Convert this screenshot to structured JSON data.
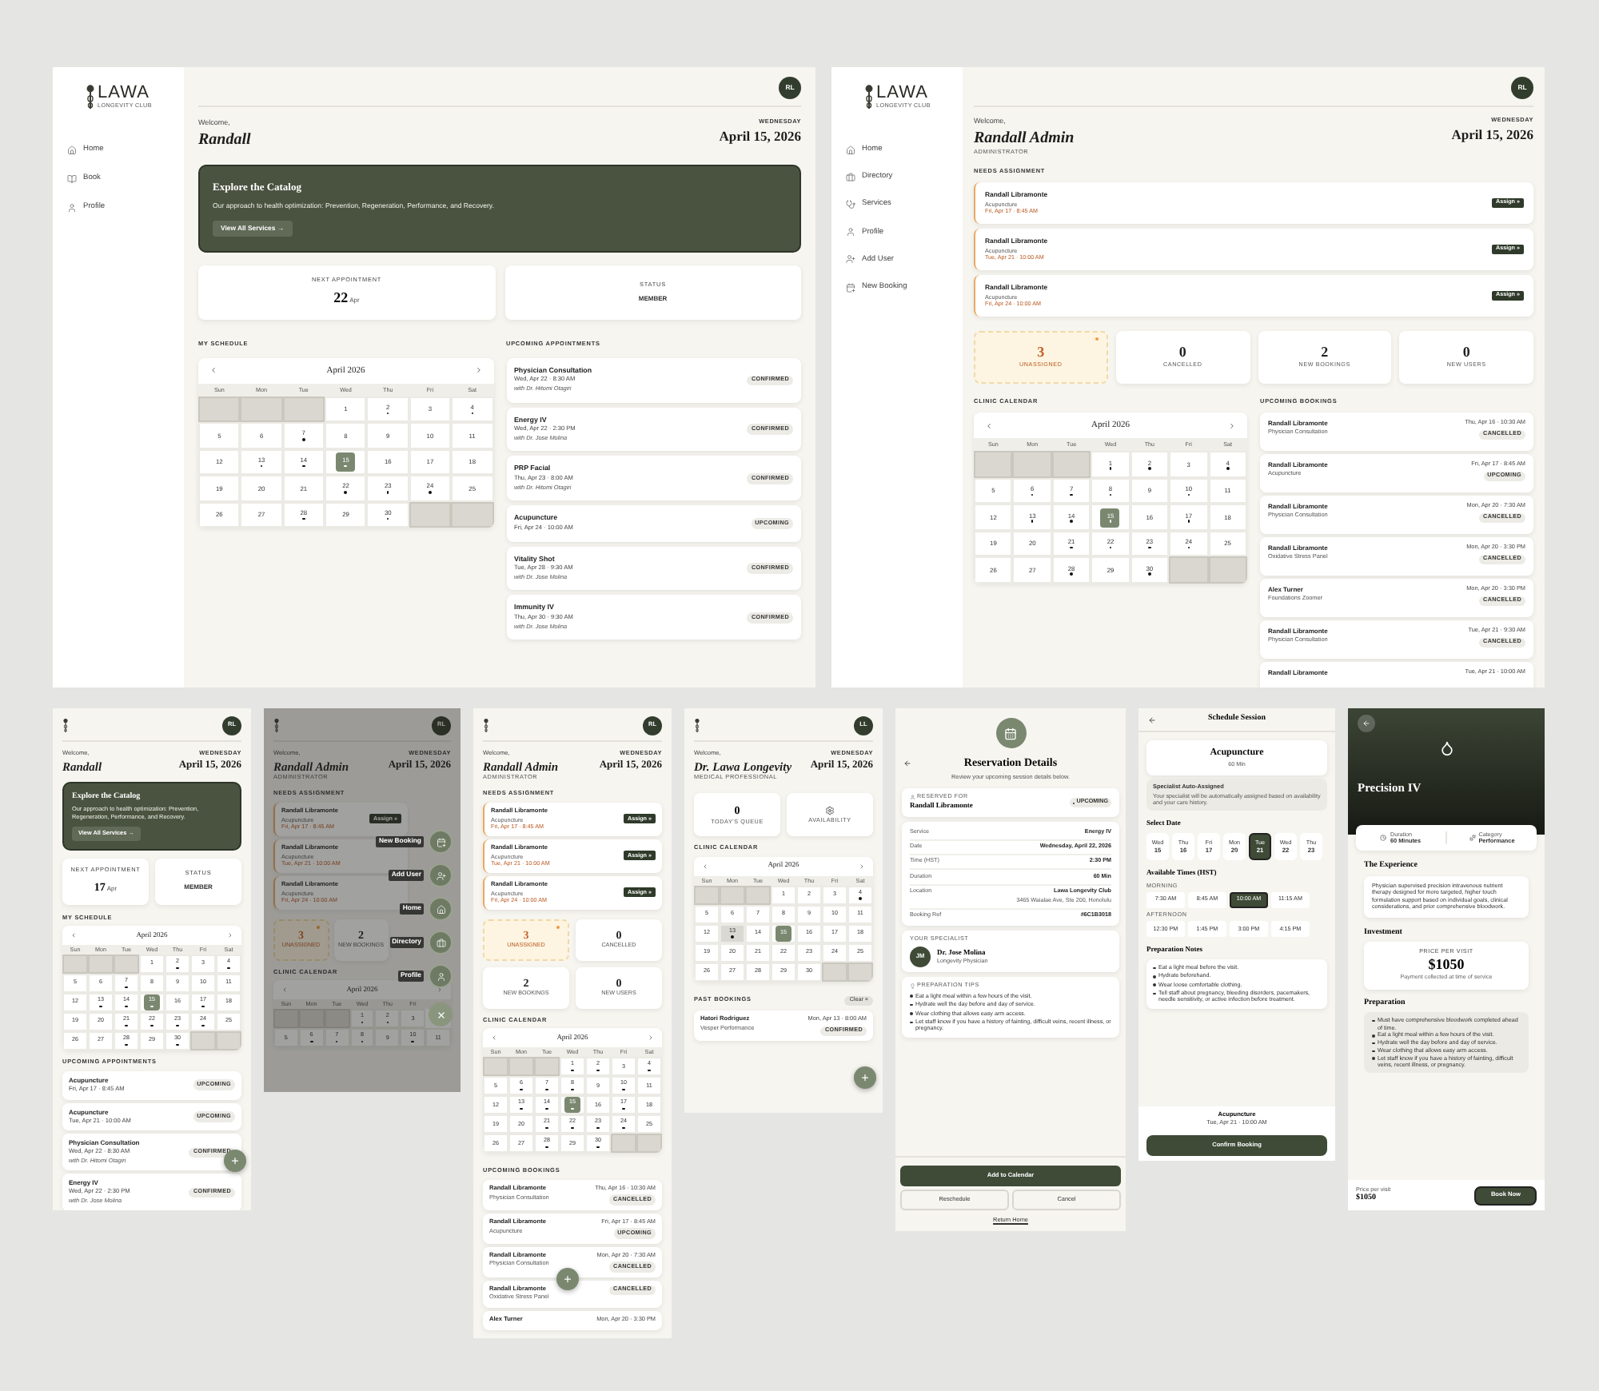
{
  "member_desktop": {
    "brand": {
      "name": "LAWA",
      "tagline": "LONGEVITY CLUB"
    },
    "nav": [
      {
        "label": "Home",
        "kind": "home"
      },
      {
        "label": "Book",
        "kind": "book"
      },
      {
        "label": "Profile",
        "kind": "profile"
      }
    ],
    "avatar": "RL",
    "greeting": "Welcome,",
    "name": "Randall",
    "weekday": "WEDNESDAY",
    "date": "April 15, 2026",
    "banner": {
      "title": "Explore the Catalog",
      "text": "Our approach to health optimization: Prevention, Regeneration, Performance, and Recovery.",
      "button": "View All Services →"
    },
    "next": {
      "label": "NEXT APPOINTMENT",
      "value": "22",
      "unit": "Apr"
    },
    "status": {
      "label": "STATUS",
      "value": "MEMBER"
    },
    "calendar_label": "MY SCHEDULE",
    "calendar": {
      "title": "April 2026",
      "weekdays": [
        "Sun",
        "Mon",
        "Tue",
        "Wed",
        "Thu",
        "Fri",
        "Sat"
      ],
      "weeks": [
        [
          {
            "kind": "empty"
          },
          {
            "kind": "empty"
          },
          {
            "kind": "empty"
          },
          {
            "kind": "day",
            "label": "1",
            "dot": false,
            "today": false
          },
          {
            "kind": "day",
            "label": "2",
            "dot": true,
            "today": false
          },
          {
            "kind": "day",
            "label": "3",
            "dot": false,
            "today": false
          },
          {
            "kind": "day",
            "label": "4",
            "dot": true,
            "today": false
          }
        ],
        [
          {
            "kind": "day",
            "label": "5",
            "dot": false,
            "today": false
          },
          {
            "kind": "day",
            "label": "6",
            "dot": false,
            "today": false
          },
          {
            "kind": "day",
            "label": "7",
            "dot": true,
            "today": false
          },
          {
            "kind": "day",
            "label": "8",
            "dot": false,
            "today": false
          },
          {
            "kind": "day",
            "label": "9",
            "dot": false,
            "today": false
          },
          {
            "kind": "day",
            "label": "10",
            "dot": false,
            "today": false
          },
          {
            "kind": "day",
            "label": "11",
            "dot": false,
            "today": false
          }
        ],
        [
          {
            "kind": "day",
            "label": "12",
            "dot": false,
            "today": false
          },
          {
            "kind": "day",
            "label": "13",
            "dot": true,
            "today": false
          },
          {
            "kind": "day",
            "label": "14",
            "dot": true,
            "today": false
          },
          {
            "kind": "day",
            "label": "15",
            "dot": true,
            "today": true
          },
          {
            "kind": "day",
            "label": "16",
            "dot": false,
            "today": false
          },
          {
            "kind": "day",
            "label": "17",
            "dot": false,
            "today": false
          },
          {
            "kind": "day",
            "label": "18",
            "dot": false,
            "today": false
          }
        ],
        [
          {
            "kind": "day",
            "label": "19",
            "dot": false,
            "today": false
          },
          {
            "kind": "day",
            "label": "20",
            "dot": false,
            "today": false
          },
          {
            "kind": "day",
            "label": "21",
            "dot": false,
            "today": false
          },
          {
            "kind": "day",
            "label": "22",
            "dot": true,
            "today": false
          },
          {
            "kind": "day",
            "label": "23",
            "dot": true,
            "today": false
          },
          {
            "kind": "day",
            "label": "24",
            "dot": true,
            "today": false
          },
          {
            "kind": "day",
            "label": "25",
            "dot": false,
            "today": false
          }
        ],
        [
          {
            "kind": "day",
            "label": "26",
            "dot": false,
            "today": false
          },
          {
            "kind": "day",
            "label": "27",
            "dot": false,
            "today": false
          },
          {
            "kind": "day",
            "label": "28",
            "dot": true,
            "today": false
          },
          {
            "kind": "day",
            "label": "29",
            "dot": false,
            "today": false
          },
          {
            "kind": "day",
            "label": "30",
            "dot": true,
            "today": false
          },
          {
            "kind": "empty"
          },
          {
            "kind": "empty"
          }
        ]
      ]
    },
    "list_label": "UPCOMING APPOINTMENTS",
    "appointments": [
      {
        "service": "Physician Consultation",
        "time": "Wed, Apr 22 · 8:30 AM",
        "doctor": "with Dr. Hitomi Otagiri",
        "status": "CONFIRMED"
      },
      {
        "service": "Energy IV",
        "time": "Wed, Apr 22 · 2:30 PM",
        "doctor": "with Dr. Jose Molina",
        "status": "CONFIRMED"
      },
      {
        "service": "PRP Facial",
        "time": "Thu, Apr 23 · 8:00 AM",
        "doctor": "with Dr. Hitomi Otagiri",
        "status": "CONFIRMED"
      },
      {
        "service": "Acupuncture",
        "time": "Fri, Apr 24 · 10:00 AM",
        "status": "UPCOMING"
      },
      {
        "service": "Vitality Shot",
        "time": "Tue, Apr 28 · 9:30 AM",
        "doctor": "with Dr. Jose Molina",
        "status": "CONFIRMED"
      },
      {
        "service": "Immunity IV",
        "time": "Thu, Apr 30 · 9:30 AM",
        "doctor": "with Dr. Jose Molina",
        "status": "CONFIRMED"
      }
    ]
  },
  "admin_desktop": {
    "brand": {
      "name": "LAWA",
      "tagline": "LONGEVITY CLUB"
    },
    "nav": [
      {
        "label": "Home",
        "kind": "home"
      },
      {
        "label": "Directory",
        "kind": "directory"
      },
      {
        "label": "Services",
        "kind": "services"
      },
      {
        "label": "Profile",
        "kind": "profile"
      },
      {
        "label": "Add User",
        "kind": "add-user"
      },
      {
        "label": "New Booking",
        "kind": "new-booking"
      }
    ],
    "avatar": "RL",
    "greeting": "Welcome,",
    "name": "Randall Admin",
    "role": "ADMINISTRATOR",
    "weekday": "WEDNESDAY",
    "date": "April 15, 2026",
    "assign_label": "NEEDS ASSIGNMENT",
    "assignments": [
      {
        "name": "Randall Libramonte",
        "service": "Acupuncture",
        "time": "Fri, Apr 17 · 8:45 AM",
        "button": "Assign »"
      },
      {
        "name": "Randall Libramonte",
        "service": "Acupuncture",
        "time": "Tue, Apr 21 · 10:00 AM",
        "button": "Assign »"
      },
      {
        "name": "Randall Libramonte",
        "service": "Acupuncture",
        "time": "Fri, Apr 24 · 10:00 AM",
        "button": "Assign »"
      }
    ],
    "stats": [
      {
        "value": "3",
        "label": "UNASSIGNED",
        "kind": "alert"
      },
      {
        "value": "0",
        "label": "CANCELLED",
        "kind": "plain"
      },
      {
        "value": "2",
        "label": "NEW BOOKINGS",
        "kind": "plain"
      },
      {
        "value": "0",
        "label": "NEW USERS",
        "kind": "plain"
      }
    ],
    "calendar_label": "CLINIC CALENDAR",
    "calendar": {
      "title": "April 2026",
      "weekdays": [
        "Sun",
        "Mon",
        "Tue",
        "Wed",
        "Thu",
        "Fri",
        "Sat"
      ],
      "weeks": [
        [
          {
            "kind": "empty"
          },
          {
            "kind": "empty"
          },
          {
            "kind": "empty"
          },
          {
            "kind": "day",
            "label": "1",
            "dot": true,
            "today": false
          },
          {
            "kind": "day",
            "label": "2",
            "dot": true,
            "today": false
          },
          {
            "kind": "day",
            "label": "3",
            "dot": false,
            "today": false
          },
          {
            "kind": "day",
            "label": "4",
            "dot": true,
            "today": false
          }
        ],
        [
          {
            "kind": "day",
            "label": "5",
            "dot": false,
            "today": false
          },
          {
            "kind": "day",
            "label": "6",
            "dot": true,
            "today": false
          },
          {
            "kind": "day",
            "label": "7",
            "dot": true,
            "today": false
          },
          {
            "kind": "day",
            "label": "8",
            "dot": true,
            "today": false
          },
          {
            "kind": "day",
            "label": "9",
            "dot": false,
            "today": false
          },
          {
            "kind": "day",
            "label": "10",
            "dot": true,
            "today": false
          },
          {
            "kind": "day",
            "label": "11",
            "dot": false,
            "today": false
          }
        ],
        [
          {
            "kind": "day",
            "label": "12",
            "dot": false,
            "today": false
          },
          {
            "kind": "day",
            "label": "13",
            "dot": true,
            "today": false
          },
          {
            "kind": "day",
            "label": "14",
            "dot": true,
            "today": false
          },
          {
            "kind": "day",
            "label": "15",
            "dot": true,
            "today": true
          },
          {
            "kind": "day",
            "label": "16",
            "dot": false,
            "today": false
          },
          {
            "kind": "day",
            "label": "17",
            "dot": true,
            "today": false
          },
          {
            "kind": "day",
            "label": "18",
            "dot": false,
            "today": false
          }
        ],
        [
          {
            "kind": "day",
            "label": "19",
            "dot": false,
            "today": false
          },
          {
            "kind": "day",
            "label": "20",
            "dot": false,
            "today": false
          },
          {
            "kind": "day",
            "label": "21",
            "dot": true,
            "today": false
          },
          {
            "kind": "day",
            "label": "22",
            "dot": true,
            "today": false
          },
          {
            "kind": "day",
            "label": "23",
            "dot": true,
            "today": false
          },
          {
            "kind": "day",
            "label": "24",
            "dot": true,
            "today": false
          },
          {
            "kind": "day",
            "label": "25",
            "dot": false,
            "today": false
          }
        ],
        [
          {
            "kind": "day",
            "label": "26",
            "dot": false,
            "today": false
          },
          {
            "kind": "day",
            "label": "27",
            "dot": false,
            "today": false
          },
          {
            "kind": "day",
            "label": "28",
            "dot": true,
            "today": false
          },
          {
            "kind": "day",
            "label": "29",
            "dot": false,
            "today": false
          },
          {
            "kind": "day",
            "label": "30",
            "dot": true,
            "today": false
          },
          {
            "kind": "empty"
          },
          {
            "kind": "empty"
          }
        ]
      ]
    },
    "bookings_label": "UPCOMING BOOKINGS",
    "bookings": [
      {
        "name": "Randall Libramonte",
        "service": "Physician Consultation",
        "time": "Thu, Apr 16 · 10:30 AM",
        "status": "CANCELLED"
      },
      {
        "name": "Randall Libramonte",
        "service": "Acupuncture",
        "time": "Fri, Apr 17 · 8:45 AM",
        "status": "UPCOMING"
      },
      {
        "name": "Randall Libramonte",
        "service": "Physician Consultation",
        "time": "Mon, Apr 20 · 7:30 AM",
        "status": "CANCELLED"
      },
      {
        "name": "Randall Libramonte",
        "service": "Oxidative Stress Panel",
        "time": "Mon, Apr 20 · 3:30 PM",
        "status": "CANCELLED"
      },
      {
        "name": "Alex Turner",
        "service": "Foundations Zoomer",
        "time": "Mon, Apr 20 · 3:30 PM",
        "status": "CANCELLED"
      },
      {
        "name": "Randall Libramonte",
        "service": "Physician Consultation",
        "time": "Tue, Apr 21 · 9:30 AM",
        "status": "CANCELLED"
      },
      {
        "name": "Randall Libramonte",
        "time": "Tue, Apr 21 · 10:00 AM"
      }
    ]
  },
  "member_mobile": {
    "avatar": "RL",
    "greeting": "Welcome,",
    "name": "Randall",
    "weekday": "WEDNESDAY",
    "date": "April 15, 2026",
    "banner": {
      "title": "Explore the Catalog",
      "text": "Our approach to health optimization: Prevention, Regeneration, Performance, and Recovery.",
      "button": "View All Services →"
    },
    "next": {
      "label": "NEXT APPOINTMENT",
      "value": "17",
      "unit": "Apr"
    },
    "status": {
      "label": "STATUS",
      "value": "MEMBER"
    },
    "calendar_label": "MY SCHEDULE",
    "calendar": {
      "title": "April 2026",
      "weekdays": [
        "Sun",
        "Mon",
        "Tue",
        "Wed",
        "Thu",
        "Fri",
        "Sat"
      ],
      "weeks": [
        [
          {
            "kind": "empty"
          },
          {
            "kind": "empty"
          },
          {
            "kind": "empty"
          },
          {
            "kind": "day",
            "label": "1",
            "dot": false,
            "today": false
          },
          {
            "kind": "day",
            "label": "2",
            "dot": true,
            "today": false
          },
          {
            "kind": "day",
            "label": "3",
            "dot": false,
            "today": false
          },
          {
            "kind": "day",
            "label": "4",
            "dot": true,
            "today": false
          }
        ],
        [
          {
            "kind": "day",
            "label": "5",
            "dot": false,
            "today": false
          },
          {
            "kind": "day",
            "label": "6",
            "dot": false,
            "today": false
          },
          {
            "kind": "day",
            "label": "7",
            "dot": true,
            "today": false
          },
          {
            "kind": "day",
            "label": "8",
            "dot": false,
            "today": false
          },
          {
            "kind": "day",
            "label": "9",
            "dot": false,
            "today": false
          },
          {
            "kind": "day",
            "label": "10",
            "dot": false,
            "today": false
          },
          {
            "kind": "day",
            "label": "11",
            "dot": false,
            "today": false
          }
        ],
        [
          {
            "kind": "day",
            "label": "12",
            "dot": false,
            "today": false
          },
          {
            "kind": "day",
            "label": "13",
            "dot": true,
            "today": false
          },
          {
            "kind": "day",
            "label": "14",
            "dot": true,
            "today": false
          },
          {
            "kind": "day",
            "label": "15",
            "dot": true,
            "today": true
          },
          {
            "kind": "day",
            "label": "16",
            "dot": false,
            "today": false
          },
          {
            "kind": "day",
            "label": "17",
            "dot": true,
            "today": false
          },
          {
            "kind": "day",
            "label": "18",
            "dot": false,
            "today": false
          }
        ],
        [
          {
            "kind": "day",
            "label": "19",
            "dot": false,
            "today": false
          },
          {
            "kind": "day",
            "label": "20",
            "dot": false,
            "today": false
          },
          {
            "kind": "day",
            "label": "21",
            "dot": true,
            "today": false
          },
          {
            "kind": "day",
            "label": "22",
            "dot": true,
            "today": false
          },
          {
            "kind": "day",
            "label": "23",
            "dot": true,
            "today": false
          },
          {
            "kind": "day",
            "label": "24",
            "dot": true,
            "today": false
          },
          {
            "kind": "day",
            "label": "25",
            "dot": false,
            "today": false
          }
        ],
        [
          {
            "kind": "day",
            "label": "26",
            "dot": false,
            "today": false
          },
          {
            "kind": "day",
            "label": "27",
            "dot": false,
            "today": false
          },
          {
            "kind": "day",
            "label": "28",
            "dot": true,
            "today": false
          },
          {
            "kind": "day",
            "label": "29",
            "dot": false,
            "today": false
          },
          {
            "kind": "day",
            "label": "30",
            "dot": true,
            "today": false
          },
          {
            "kind": "empty"
          },
          {
            "kind": "empty"
          }
        ]
      ]
    },
    "list_label": "UPCOMING APPOINTMENTS",
    "appointments": [
      {
        "service": "Acupuncture",
        "time": "Fri, Apr 17 · 8:45 AM",
        "status": "UPCOMING"
      },
      {
        "service": "Acupuncture",
        "time": "Tue, Apr 21 · 10:00 AM",
        "status": "UPCOMING"
      },
      {
        "service": "Physician Consultation",
        "time": "Wed, Apr 22 · 8:30 AM",
        "doctor": "with Dr. Hitomi Otagiri",
        "status": "CONFIRMED"
      },
      {
        "service": "Energy IV",
        "time": "Wed, Apr 22 · 2:30 PM",
        "doctor": "with Dr. Jose Molina",
        "status": "CONFIRMED"
      }
    ]
  },
  "admin_mobile_menu": {
    "avatar": "RL",
    "greeting": "Welcome,",
    "name": "Randall Admin",
    "role": "ADMINISTRATOR",
    "weekday": "WEDNESDAY",
    "date": "April 15, 2026",
    "assign_label": "NEEDS ASSIGNMENT",
    "assignments": [
      {
        "name": "Randall Libramonte",
        "service": "Acupuncture",
        "time": "Fri, Apr 17 · 8:45 AM",
        "button": "Assign »"
      },
      {
        "name": "Randall Libramonte",
        "service": "Acupuncture",
        "time": "Tue, Apr 21 · 10:00 AM"
      },
      {
        "name": "Randall Libramonte",
        "service": "Acupuncture",
        "time": "Fri, Apr 24 · 10:00 AM"
      }
    ],
    "stats": [
      {
        "value": "3",
        "label": "UNASSIGNED",
        "kind": "alert"
      },
      {
        "value": "2",
        "label": "NEW BOOKINGS",
        "kind": "plain"
      }
    ],
    "calendar_label": "CLINIC CALENDAR",
    "calendar": {
      "title": "April 2026",
      "weekdays": [
        "Sun",
        "Mon",
        "Tue",
        "Wed",
        "Thu",
        "Fri"
      ],
      "weeks": [
        [
          {
            "kind": "empty"
          },
          {
            "kind": "empty"
          },
          {
            "kind": "empty"
          },
          {
            "kind": "day",
            "label": "1",
            "dot": true,
            "today": false
          },
          {
            "kind": "day",
            "label": "2",
            "dot": true,
            "today": false
          },
          {
            "kind": "day",
            "label": "3",
            "dot": false,
            "today": false
          }
        ],
        [
          {
            "kind": "day",
            "label": "5",
            "dot": false,
            "today": false
          },
          {
            "kind": "day",
            "label": "6",
            "dot": true,
            "today": false
          },
          {
            "kind": "day",
            "label": "7",
            "dot": true,
            "today": false
          },
          {
            "kind": "day",
            "label": "8",
            "dot": true,
            "today": false
          },
          {
            "kind": "day",
            "label": "9",
            "dot": false,
            "today": false
          },
          {
            "kind": "day",
            "label": "10",
            "dot": true,
            "today": false
          },
          {
            "kind": "day",
            "label": "11",
            "dot": false,
            "today": false
          }
        ]
      ]
    },
    "menu": [
      {
        "label": "New Booking",
        "kind": "new-booking"
      },
      {
        "label": "Add User",
        "kind": "add-user"
      },
      {
        "label": "Home",
        "kind": "home"
      },
      {
        "label": "Directory",
        "kind": "directory"
      },
      {
        "label": "Profile",
        "kind": "profile"
      }
    ]
  },
  "admin_mobile": {
    "avatar": "RL",
    "greeting": "Welcome,",
    "name": "Randall Admin",
    "role": "ADMINISTRATOR",
    "weekday": "WEDNESDAY",
    "date": "April 15, 2026",
    "assign_label": "NEEDS ASSIGNMENT",
    "assignments": [
      {
        "name": "Randall Libramonte",
        "service": "Acupuncture",
        "time": "Fri, Apr 17 · 8:45 AM",
        "button": "Assign »"
      },
      {
        "name": "Randall Libramonte",
        "service": "Acupuncture",
        "time": "Tue, Apr 21 · 10:00 AM",
        "button": "Assign »"
      },
      {
        "name": "Randall Libramonte",
        "service": "Acupuncture",
        "time": "Fri, Apr 24 · 10:00 AM",
        "button": "Assign »"
      }
    ],
    "stats": [
      {
        "value": "3",
        "label": "UNASSIGNED",
        "kind": "alert"
      },
      {
        "value": "0",
        "label": "CANCELLED",
        "kind": "plain"
      },
      {
        "value": "2",
        "label": "NEW BOOKINGS",
        "kind": "plain"
      },
      {
        "value": "0",
        "label": "NEW USERS",
        "kind": "plain"
      }
    ],
    "calendar_label": "CLINIC CALENDAR",
    "calendar": {
      "title": "April 2026",
      "weekdays": [
        "Sun",
        "Mon",
        "Tue",
        "Wed",
        "Thu",
        "Fri",
        "Sat"
      ],
      "weeks": [
        [
          {
            "kind": "empty"
          },
          {
            "kind": "empty"
          },
          {
            "kind": "empty"
          },
          {
            "kind": "day",
            "label": "1",
            "dot": true,
            "today": false
          },
          {
            "kind": "day",
            "label": "2",
            "dot": true,
            "today": false
          },
          {
            "kind": "day",
            "label": "3",
            "dot": false,
            "today": false
          },
          {
            "kind": "day",
            "label": "4",
            "dot": true,
            "today": false
          }
        ],
        [
          {
            "kind": "day",
            "label": "5",
            "dot": false,
            "today": false
          },
          {
            "kind": "day",
            "label": "6",
            "dot": true,
            "today": false
          },
          {
            "kind": "day",
            "label": "7",
            "dot": true,
            "today": false
          },
          {
            "kind": "day",
            "label": "8",
            "dot": true,
            "today": false
          },
          {
            "kind": "day",
            "label": "9",
            "dot": false,
            "today": false
          },
          {
            "kind": "day",
            "label": "10",
            "dot": true,
            "today": false
          },
          {
            "kind": "day",
            "label": "11",
            "dot": false,
            "today": false
          }
        ],
        [
          {
            "kind": "day",
            "label": "12",
            "dot": false,
            "today": false
          },
          {
            "kind": "day",
            "label": "13",
            "dot": true,
            "today": false
          },
          {
            "kind": "day",
            "label": "14",
            "dot": true,
            "today": false
          },
          {
            "kind": "day",
            "label": "15",
            "dot": true,
            "today": true
          },
          {
            "kind": "day",
            "label": "16",
            "dot": false,
            "today": false
          },
          {
            "kind": "day",
            "label": "17",
            "dot": true,
            "today": false
          },
          {
            "kind": "day",
            "label": "18",
            "dot": false,
            "today": false
          }
        ],
        [
          {
            "kind": "day",
            "label": "19",
            "dot": false,
            "today": false
          },
          {
            "kind": "day",
            "label": "20",
            "dot": false,
            "today": false
          },
          {
            "kind": "day",
            "label": "21",
            "dot": true,
            "today": false
          },
          {
            "kind": "day",
            "label": "22",
            "dot": true,
            "today": false
          },
          {
            "kind": "day",
            "label": "23",
            "dot": true,
            "today": false
          },
          {
            "kind": "day",
            "label": "24",
            "dot": true,
            "today": false
          },
          {
            "kind": "day",
            "label": "25",
            "dot": false,
            "today": false
          }
        ],
        [
          {
            "kind": "day",
            "label": "26",
            "dot": false,
            "today": false
          },
          {
            "kind": "day",
            "label": "27",
            "dot": false,
            "today": false
          },
          {
            "kind": "day",
            "label": "28",
            "dot": true,
            "today": false
          },
          {
            "kind": "day",
            "label": "29",
            "dot": false,
            "today": false
          },
          {
            "kind": "day",
            "label": "30",
            "dot": true,
            "today": false
          },
          {
            "kind": "empty"
          },
          {
            "kind": "empty"
          }
        ]
      ]
    },
    "bookings_label": "UPCOMING BOOKINGS",
    "bookings": [
      {
        "name": "Randall Libramonte",
        "service": "Physician Consultation",
        "time": "Thu, Apr 16 · 10:30 AM",
        "status": "CANCELLED"
      },
      {
        "name": "Randall Libramonte",
        "service": "Acupuncture",
        "time": "Fri, Apr 17 · 8:45 AM",
        "status": "UPCOMING"
      },
      {
        "name": "Randall Libramonte",
        "service": "Physician Consultation",
        "time": "Mon, Apr 20 · 7:30 AM",
        "status": "CANCELLED"
      },
      {
        "name": "Randall Libramonte",
        "service": "Oxidative Stress Panel",
        "status": "CANCELLED"
      },
      {
        "name": "Alex Turner",
        "time": "Mon, Apr 20 · 3:30 PM"
      }
    ]
  },
  "doctor_mobile": {
    "avatar": "LL",
    "greeting": "Welcome,",
    "name": "Dr. Lawa Longevity",
    "role": "MEDICAL PROFESSIONAL",
    "weekday": "WEDNESDAY",
    "date": "April 15, 2026",
    "stats": [
      {
        "value": "0",
        "label": "TODAY'S QUEUE",
        "kind": "number"
      },
      {
        "label": "AVAILABILITY",
        "kind": "gear"
      }
    ],
    "calendar_label": "CLINIC CALENDAR",
    "calendar": {
      "title": "April 2026",
      "weekdays": [
        "Sun",
        "Mon",
        "Tue",
        "Wed",
        "Thu",
        "Fri",
        "Sat"
      ],
      "weeks": [
        [
          {
            "kind": "empty"
          },
          {
            "kind": "empty"
          },
          {
            "kind": "empty"
          },
          {
            "kind": "day",
            "label": "1",
            "dot": false,
            "today": false,
            "selected": false
          },
          {
            "kind": "day",
            "label": "2",
            "dot": false,
            "today": false,
            "selected": false
          },
          {
            "kind": "day",
            "label": "3",
            "dot": false,
            "today": false,
            "selected": false
          },
          {
            "kind": "day",
            "label": "4",
            "dot": true,
            "today": false,
            "selected": false
          }
        ],
        [
          {
            "kind": "day",
            "label": "5",
            "dot": false,
            "today": false,
            "selected": false
          },
          {
            "kind": "day",
            "label": "6",
            "dot": false,
            "today": false,
            "selected": false
          },
          {
            "kind": "day",
            "label": "7",
            "dot": false,
            "today": false,
            "selected": false
          },
          {
            "kind": "day",
            "label": "8",
            "dot": false,
            "today": false,
            "selected": false
          },
          {
            "kind": "day",
            "label": "9",
            "dot": false,
            "today": false,
            "selected": false
          },
          {
            "kind": "day",
            "label": "10",
            "dot": false,
            "today": false,
            "selected": false
          },
          {
            "kind": "day",
            "label": "11",
            "dot": false,
            "today": false,
            "selected": false
          }
        ],
        [
          {
            "kind": "day",
            "label": "12",
            "dot": false,
            "today": false,
            "selected": false
          },
          {
            "kind": "day",
            "label": "13",
            "dot": true,
            "today": false,
            "selected": true
          },
          {
            "kind": "day",
            "label": "14",
            "dot": false,
            "today": false,
            "selected": false
          },
          {
            "kind": "day",
            "label": "15",
            "dot": false,
            "today": true,
            "selected": false
          },
          {
            "kind": "day",
            "label": "16",
            "dot": false,
            "today": false,
            "selected": false
          },
          {
            "kind": "day",
            "label": "17",
            "dot": false,
            "today": false,
            "selected": false
          },
          {
            "kind": "day",
            "label": "18",
            "dot": false,
            "today": false,
            "selected": false
          }
        ],
        [
          {
            "kind": "day",
            "label": "19",
            "dot": false,
            "today": false,
            "selected": false
          },
          {
            "kind": "day",
            "label": "20",
            "dot": false,
            "today": false,
            "selected": false
          },
          {
            "kind": "day",
            "label": "21",
            "dot": false,
            "today": false,
            "selected": false
          },
          {
            "kind": "day",
            "label": "22",
            "dot": false,
            "today": false,
            "selected": false
          },
          {
            "kind": "day",
            "label": "23",
            "dot": false,
            "today": false,
            "selected": false
          },
          {
            "kind": "day",
            "label": "24",
            "dot": false,
            "today": false,
            "selected": false
          },
          {
            "kind": "day",
            "label": "25",
            "dot": false,
            "today": false,
            "selected": false
          }
        ],
        [
          {
            "kind": "day",
            "label": "26",
            "dot": false,
            "today": false,
            "selected": false
          },
          {
            "kind": "day",
            "label": "27",
            "dot": false,
            "today": false,
            "selected": false
          },
          {
            "kind": "day",
            "label": "28",
            "dot": false,
            "today": false,
            "selected": false
          },
          {
            "kind": "day",
            "label": "29",
            "dot": false,
            "today": false,
            "selected": false
          },
          {
            "kind": "day",
            "label": "30",
            "dot": false,
            "today": false,
            "selected": false
          },
          {
            "kind": "empty"
          },
          {
            "kind": "empty"
          }
        ]
      ]
    },
    "past_label": "PAST BOOKINGS",
    "clear": "Clear ×",
    "bookings": [
      {
        "name": "Hatori Rodriguez",
        "service": "Vesper Performance",
        "time": "Mon, Apr 13 · 8:00 AM",
        "status": "CONFIRMED"
      }
    ]
  },
  "reservation": {
    "title": "Reservation Details",
    "subtitle": "Review your upcoming session details below.",
    "reserved_label": "RESERVED FOR",
    "client": "Randall Libramonte",
    "badge": "UPCOMING",
    "details": [
      {
        "label": "Service",
        "value": "Energy IV"
      },
      {
        "label": "Date",
        "value": "Wednesday, April 22, 2026"
      },
      {
        "label": "Time (HST)",
        "value": "2:30 PM"
      },
      {
        "label": "Duration",
        "value": "60 Min"
      },
      {
        "label": "Location",
        "value": "Lawa Longevity Club",
        "extra": "3465 Waialae Ave, Ste 200, Honolulu"
      },
      {
        "label": "Booking Ref",
        "value": "#6C1B3018"
      }
    ],
    "specialist_label": "YOUR SPECIALIST",
    "initials": "JM",
    "doctor": "Dr. Jose Molina",
    "doctor_role": "Longevity Physician",
    "tips_label": "PREPARATION TIPS",
    "tips": [
      "Eat a light meal within a few hours of the visit.",
      "Hydrate well the day before and day of service.",
      "Wear clothing that allows easy arm access.",
      "Let staff know if you have a history of fainting, difficult veins, recent illness, or pregnancy."
    ],
    "primary": "Add to Calendar",
    "secondary": [
      "Reschedule",
      "Cancel"
    ],
    "link": "Return Home"
  },
  "schedule": {
    "title": "Schedule Session",
    "service": "Acupuncture",
    "duration": "60 Min",
    "auto_title": "Specialist Auto-Assigned",
    "auto_text": "Your specialist will be automatically assigned based on availability and your care history.",
    "date_label": "Select Date",
    "dates": [
      {
        "day": "Wed",
        "num": "15",
        "selected": false
      },
      {
        "day": "Thu",
        "num": "16",
        "selected": false
      },
      {
        "day": "Fri",
        "num": "17",
        "selected": false
      },
      {
        "day": "Mon",
        "num": "20",
        "selected": false
      },
      {
        "day": "Tue",
        "num": "21",
        "selected": true
      },
      {
        "day": "Wed",
        "num": "22",
        "selected": false
      },
      {
        "day": "Thu",
        "num": "23",
        "selected": false
      }
    ],
    "times_label": "Available Times (HST)",
    "groups": [
      {
        "label": "MORNING",
        "times": [
          {
            "label": "7:30 AM",
            "selected": false
          },
          {
            "label": "8:45 AM",
            "selected": false
          },
          {
            "label": "10:00 AM",
            "selected": true
          },
          {
            "label": "11:15 AM",
            "selected": false
          }
        ]
      },
      {
        "label": "AFTERNOON",
        "times": [
          {
            "label": "12:30 PM",
            "selected": false
          },
          {
            "label": "1:45 PM",
            "selected": false
          },
          {
            "label": "3:00 PM",
            "selected": false
          },
          {
            "label": "4:15 PM",
            "selected": false
          }
        ]
      }
    ],
    "notes_label": "Preparation Notes",
    "notes": [
      "Eat a light meal before the visit.",
      "Hydrate beforehand.",
      "Wear loose comfortable clothing.",
      "Tell staff about pregnancy, bleeding disorders, pacemakers, needle sensitivity, or active infection before treatment."
    ],
    "footer_service": "Acupuncture",
    "footer_time": "Tue, Apr 21 · 10:00 AM",
    "confirm": "Confirm Booking"
  },
  "service": {
    "title": "Precision IV",
    "meta": [
      {
        "label": "Duration",
        "value": "60 Minutes",
        "kind": "clock"
      },
      {
        "label": "Category",
        "value": "Performance",
        "kind": "dumbbell"
      }
    ],
    "experience_title": "The Experience",
    "experience_text": "Physician supervised precision intravenous nutrient therapy designed for more targeted, higher touch formulation support based on individual goals, clinical considerations, and prior comprehensive bloodwork.",
    "investment_title": "Investment",
    "price_label": "PRICE PER VISIT",
    "price": "$1050",
    "price_note": "Payment collected at time of service",
    "prep_title": "Preparation",
    "prep": [
      "Must have comprehensive bloodwork completed ahead of time.",
      "Eat a light meal within a few hours of the visit.",
      "Hydrate well the day before and day of service.",
      "Wear clothing that allows easy arm access.",
      "Let staff know if you have a history of fainting, difficult veins, recent illness, or pregnancy."
    ],
    "footer_label": "Price per visit",
    "footer_price": "$1050",
    "book": "Book Now"
  }
}
